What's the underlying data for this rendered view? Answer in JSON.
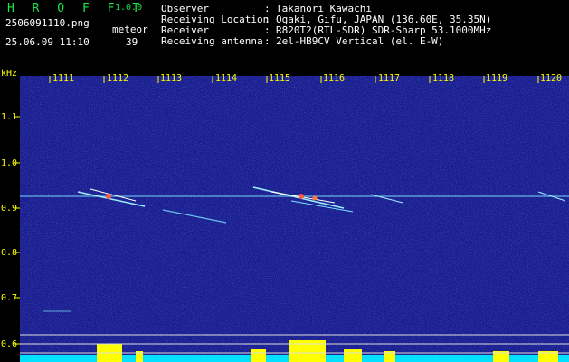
{
  "header": {
    "app_title": "H R O F F T",
    "app_version": "1.0.0",
    "file_name": "2506091110.png",
    "datetime": "25.06.09 11:10",
    "meteor_label": "meteor",
    "meteor_count": "39",
    "info": [
      {
        "key": "Observer",
        "value": "Takanori Kawachi"
      },
      {
        "key": "Receiving Location",
        "value": "Ogaki, Gifu, JAPAN (136.60E, 35.35N)"
      },
      {
        "key": "Receiver",
        "value": "R820T2(RTL-SDR) SDR-Sharp 53.1000MHz"
      },
      {
        "key": "Receiving antenna",
        "value": "2el-HB9CV Vertical (el. E-W)"
      }
    ],
    "separator": ":"
  },
  "spectrogram": {
    "y_unit": "kHz",
    "y_ticks": [
      "1.1",
      "1.0",
      "0.9",
      "0.8",
      "0.7",
      "0.6"
    ],
    "x_ticks": [
      "1111",
      "1112",
      "1113",
      "1114",
      "1115",
      "1116",
      "1117",
      "1118",
      "1119",
      "1120"
    ]
  },
  "colors": {
    "background": "#1a1a8c",
    "title_green": "#19e64a",
    "axis_text": "#ffff00",
    "signal_line": "#9ff0ff",
    "count_bar": "#ffff00",
    "baseline": "#00e0ff"
  }
}
